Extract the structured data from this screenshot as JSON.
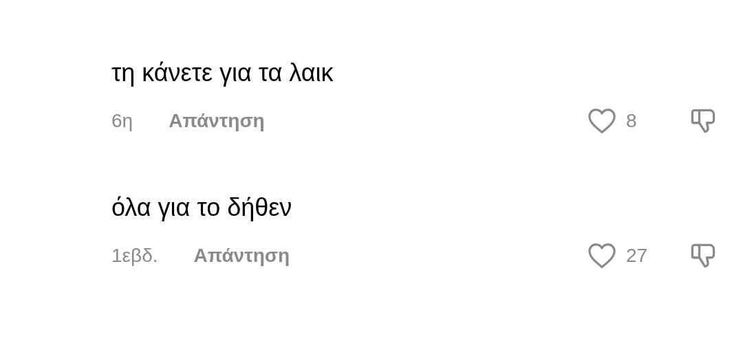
{
  "comments": [
    {
      "text": "τη κάνετε για τα λαικ",
      "time": "6η",
      "reply": "Απάντηση",
      "likes": "8",
      "liked": false
    },
    {
      "text": "όλα για το δήθεν",
      "time": "1εβδ.",
      "reply": "Απάντηση",
      "likes": "27",
      "liked": false
    }
  ]
}
